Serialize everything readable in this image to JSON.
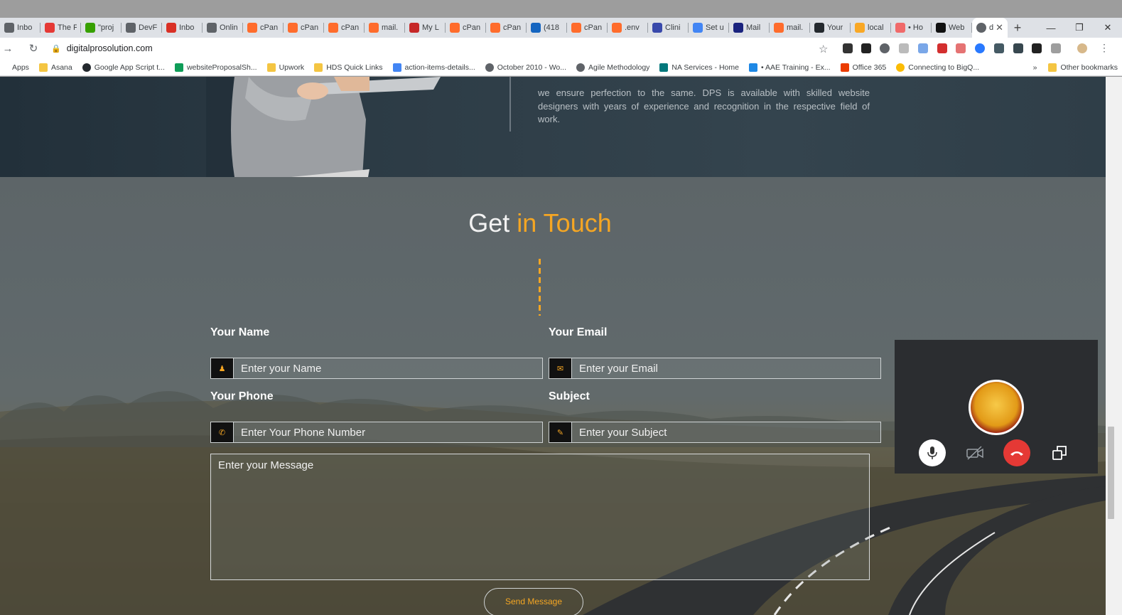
{
  "browser": {
    "tabs": [
      {
        "label": "Inbo",
        "icon": "inbox-icon",
        "color": "#5f6368"
      },
      {
        "label": "The F",
        "icon": "red-diamond-icon",
        "color": "#e53935"
      },
      {
        "label": "\"proj",
        "icon": "upwork-icon",
        "color": "#37a000"
      },
      {
        "label": "DevF",
        "icon": "globe-icon",
        "color": "#5f6368"
      },
      {
        "label": "Inbo",
        "icon": "gmail-icon",
        "color": "#d93025"
      },
      {
        "label": "Onlin",
        "icon": "grid-icon",
        "color": "#5f6368"
      },
      {
        "label": "cPan",
        "icon": "cpanel-icon",
        "color": "#ff6c2c"
      },
      {
        "label": "cPan",
        "icon": "cpanel-icon",
        "color": "#ff6c2c"
      },
      {
        "label": "cPan",
        "icon": "cpanel-icon",
        "color": "#ff6c2c"
      },
      {
        "label": "mail.",
        "icon": "cpanel-icon",
        "color": "#ff6c2c"
      },
      {
        "label": "My L",
        "icon": "calendar-icon",
        "color": "#c62828"
      },
      {
        "label": "cPan",
        "icon": "cpanel-icon",
        "color": "#ff6c2c"
      },
      {
        "label": "cPan",
        "icon": "cpanel-icon",
        "color": "#ff6c2c"
      },
      {
        "label": "(418",
        "icon": "chat-icon",
        "color": "#1565c0"
      },
      {
        "label": "cPan",
        "icon": "cpanel-icon",
        "color": "#ff6c2c"
      },
      {
        "label": ".env",
        "icon": "cpanel-icon",
        "color": "#ff6c2c"
      },
      {
        "label": "Clini",
        "icon": "clinic-icon",
        "color": "#3949ab"
      },
      {
        "label": "Set u",
        "icon": "google-icon",
        "color": "#4285f4"
      },
      {
        "label": "Mail",
        "icon": "mail-icon",
        "color": "#1a237e"
      },
      {
        "label": "mail.",
        "icon": "cpanel-icon",
        "color": "#ff6c2c"
      },
      {
        "label": "Your",
        "icon": "github-icon",
        "color": "#24292e"
      },
      {
        "label": "local",
        "icon": "pencil-icon",
        "color": "#f9a825"
      },
      {
        "label": "• Ho",
        "icon": "asana-icon",
        "color": "#f06a6a"
      },
      {
        "label": "Web",
        "icon": "web-icon",
        "color": "#111111"
      }
    ],
    "active_tab": {
      "label": "d",
      "icon": "globe-icon"
    },
    "new_tab_label": "+",
    "url": "digitalprosolution.com",
    "bookmarks": [
      {
        "label": "Apps",
        "icon": "apps-icon"
      },
      {
        "label": "Asana",
        "icon": "folder-icon"
      },
      {
        "label": "Google App Script t...",
        "icon": "github-icon"
      },
      {
        "label": "websiteProposalSh...",
        "icon": "sheets-icon"
      },
      {
        "label": "Upwork",
        "icon": "folder-icon"
      },
      {
        "label": "HDS Quick Links",
        "icon": "folder-icon"
      },
      {
        "label": "action-items-details...",
        "icon": "docs-icon"
      },
      {
        "label": "October 2010 - Wo...",
        "icon": "globe-icon"
      },
      {
        "label": "Agile Methodology",
        "icon": "globe-icon"
      },
      {
        "label": "NA Services - Home",
        "icon": "sharepoint-icon"
      },
      {
        "label": "• AAE Training - Ex...",
        "icon": "training-icon"
      },
      {
        "label": "Office 365",
        "icon": "office-icon"
      },
      {
        "label": "Connecting to BigQ...",
        "icon": "chrome-icon"
      }
    ],
    "bookmarks_more": "»",
    "other_bookmarks": "Other bookmarks"
  },
  "hero": {
    "text": "we ensure perfection to the same. DPS is available with skilled website designers with years of experience and recognition in the respective field of work."
  },
  "contact": {
    "title_part1": "Get",
    "title_part2": "in Touch",
    "name_label": "Your Name",
    "name_placeholder": "Enter your Name",
    "email_label": "Your Email",
    "email_placeholder": "Enter your Email",
    "phone_label": "Your Phone",
    "phone_placeholder": "Enter Your Phone Number",
    "subject_label": "Subject",
    "subject_placeholder": "Enter your Subject",
    "message_placeholder": "Enter your Message",
    "send_label": "Send Message",
    "accent_color": "#f5a623"
  },
  "call_widget": {
    "avatar": "iron-man-avatar",
    "buttons": [
      "microphone-icon",
      "camera-off-icon",
      "hang-up-icon",
      "popout-icon"
    ],
    "hangup_color": "#e53935"
  }
}
